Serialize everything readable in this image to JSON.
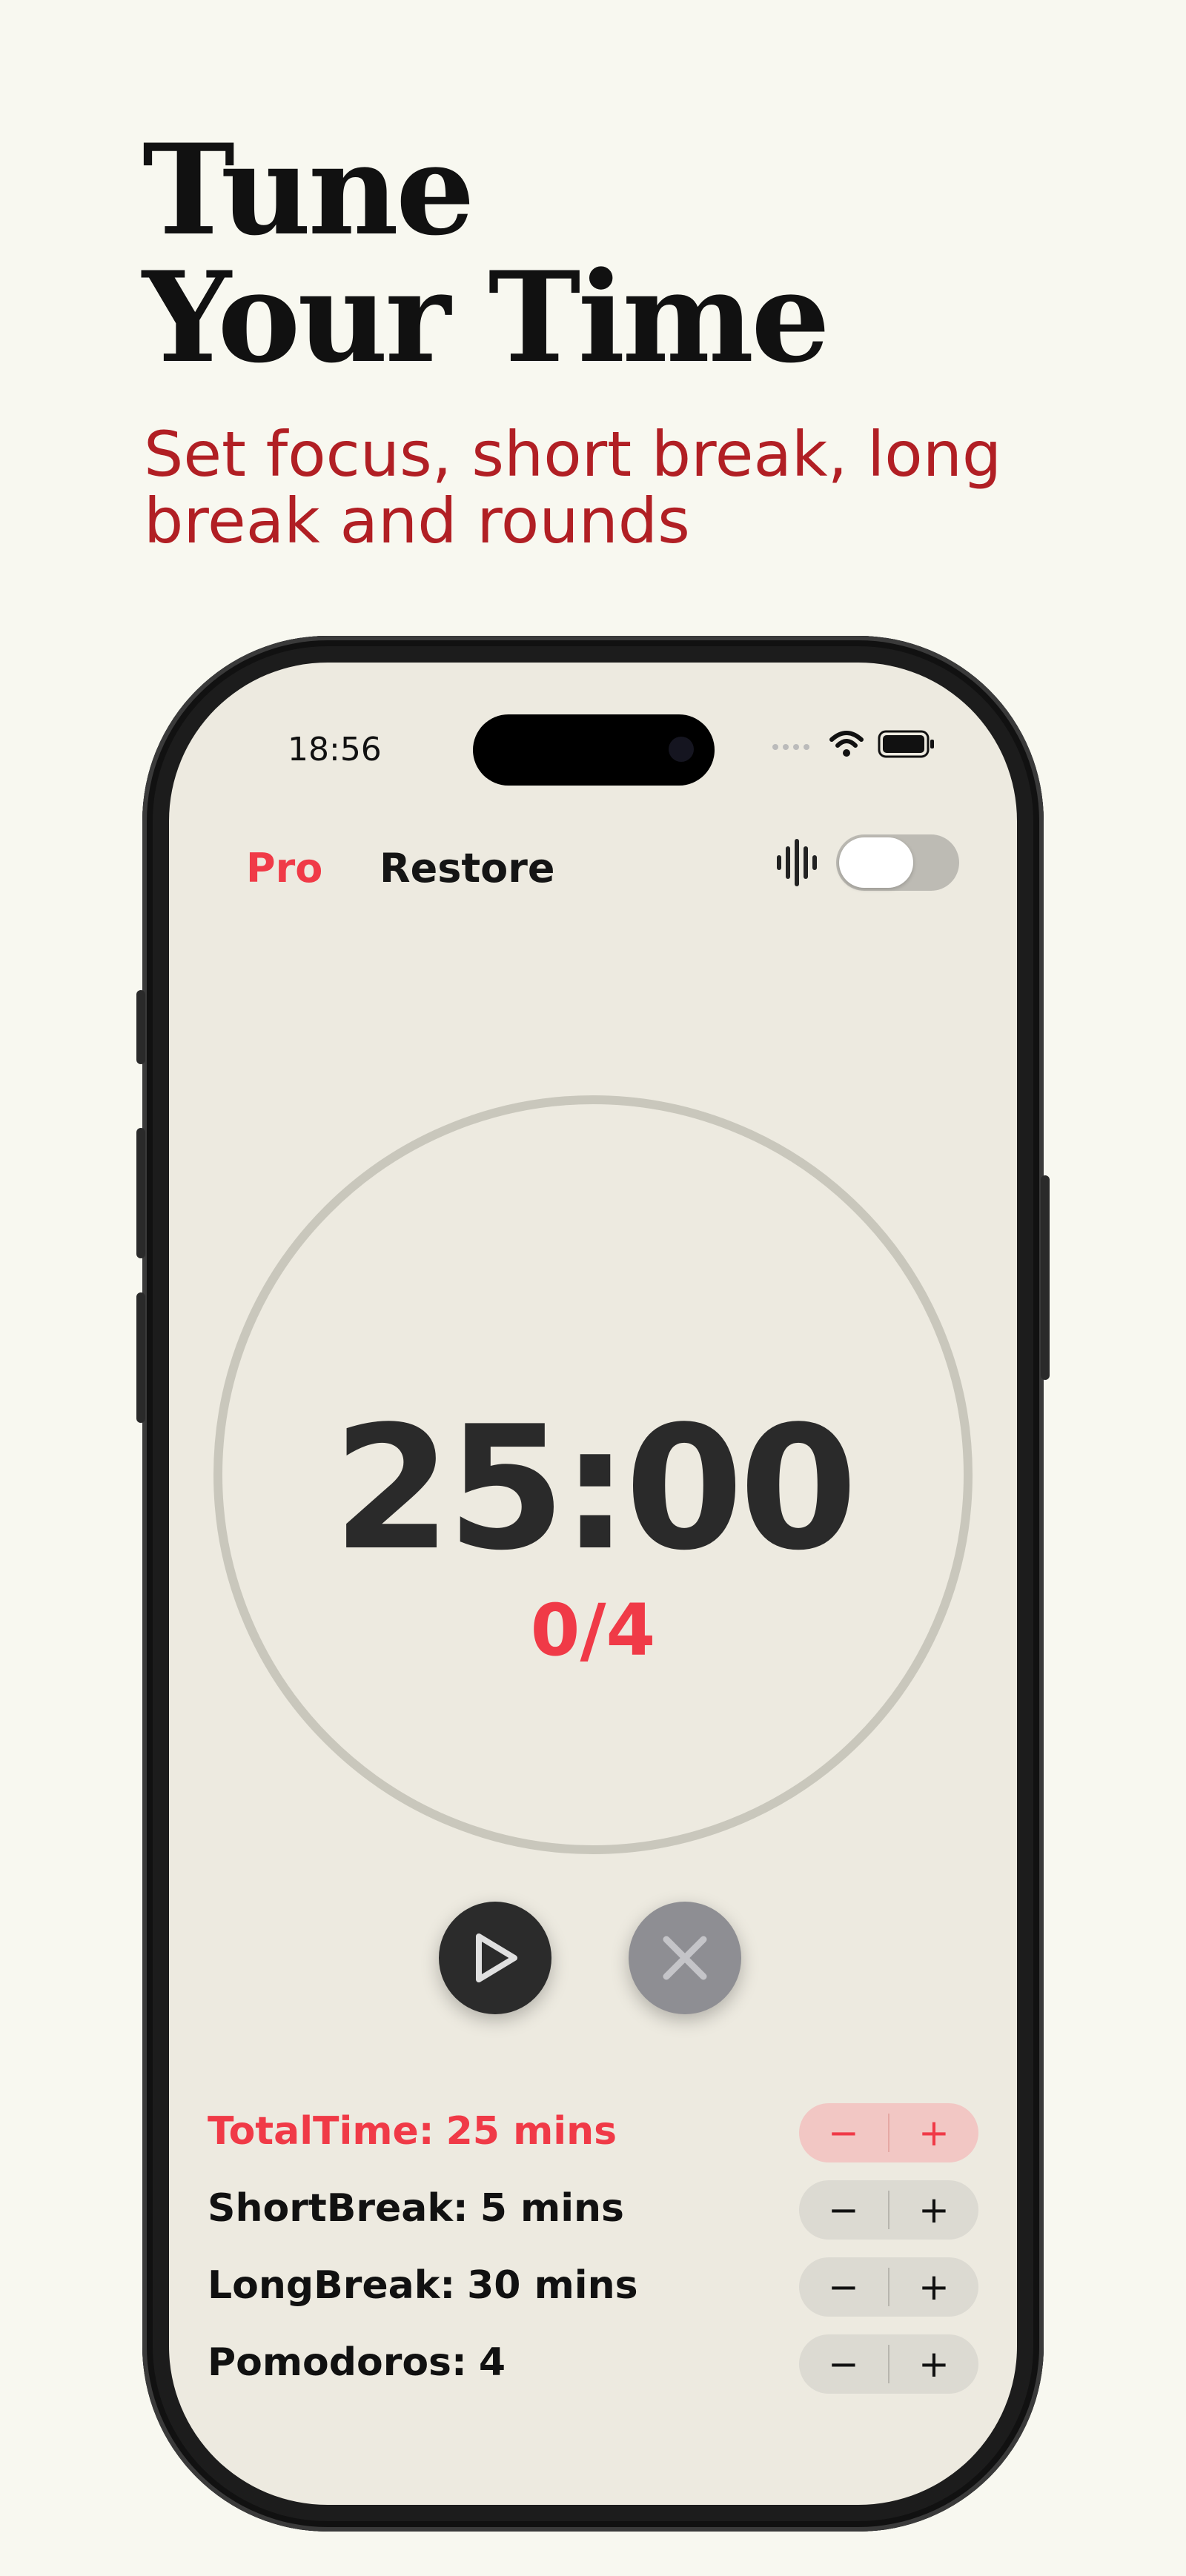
{
  "headline": {
    "line1": "Tune",
    "line2": "Your Time"
  },
  "subhead": "Set focus, short break, long break and rounds",
  "status_bar": {
    "time": "18:56"
  },
  "top_bar": {
    "pro_label": "Pro",
    "restore_label": "Restore",
    "sound_toggle_on": false
  },
  "timer": {
    "time": "25:00",
    "rounds": "0/4"
  },
  "settings": [
    {
      "label": "TotalTime:",
      "value": "25 mins",
      "active": true
    },
    {
      "label": "ShortBreak:",
      "value": "5 mins",
      "active": false
    },
    {
      "label": "LongBreak:",
      "value": "30 mins",
      "active": false
    },
    {
      "label": "Pomodoros:",
      "value": "4",
      "active": false
    }
  ],
  "stepper": {
    "minus": "−",
    "plus": "+"
  },
  "colors": {
    "accent": "#f03a47",
    "headline_sub": "#b11f24",
    "screen_bg": "#edeae0"
  }
}
